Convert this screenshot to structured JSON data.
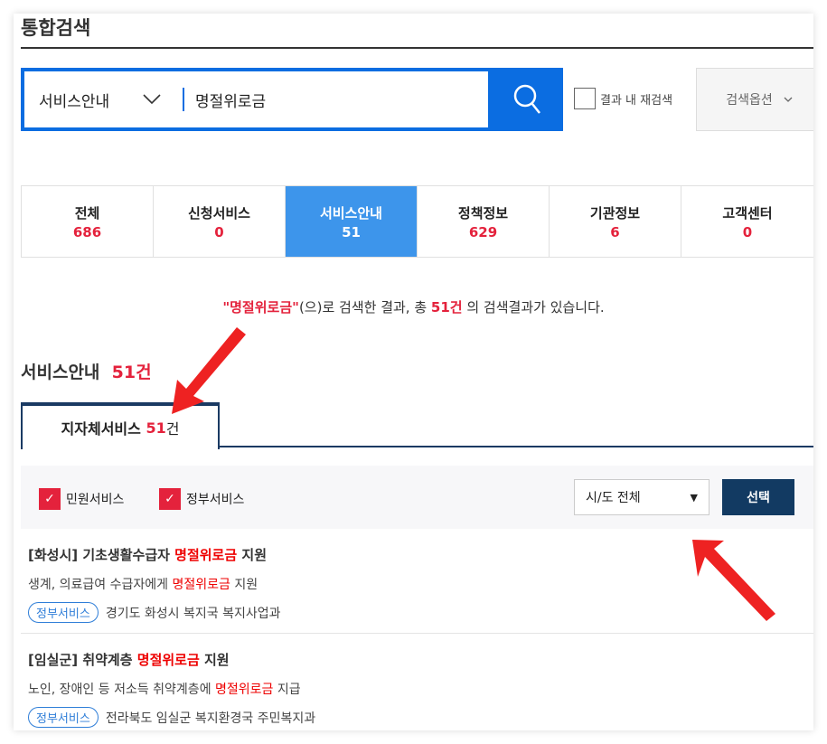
{
  "header": {
    "title": "통합검색"
  },
  "search": {
    "category": "서비스안내",
    "query": "명절위로금",
    "research_label": "결과 내 재검색",
    "options_label": "검색옵션",
    "icon": "search-icon"
  },
  "tabs": [
    {
      "label": "전체",
      "count": "686"
    },
    {
      "label": "신청서비스",
      "count": "0"
    },
    {
      "label": "서비스안내",
      "count": "51",
      "active": true
    },
    {
      "label": "정책정보",
      "count": "629"
    },
    {
      "label": "기관정보",
      "count": "6"
    },
    {
      "label": "고객센터",
      "count": "0"
    }
  ],
  "summary": {
    "q1": "\"명절위로금\"",
    "t1": "(으)로 검색한 결과, 총 ",
    "count": "51건",
    "t2": " 의 검색결과가 있습니다."
  },
  "section": {
    "title": "서비스안내",
    "count": "51건"
  },
  "subtab": {
    "label": "지자체서비스",
    "count": "51",
    "unit": "건"
  },
  "filter": {
    "checks": [
      {
        "label": "민원서비스",
        "checked": true
      },
      {
        "label": "정부서비스",
        "checked": true
      }
    ],
    "select": "시/도 전체",
    "button": "선택"
  },
  "results": [
    {
      "title_pre": "[화성시] 기초생활수급자 ",
      "title_hl": "명절위로금",
      "title_post": " 지원",
      "desc_pre": "생계, 의료급여 수급자에게 ",
      "desc_hl": "명절위로금",
      "desc_post": " 지원",
      "badge": "정부서비스",
      "org": "경기도 화성시 복지국 복지사업과"
    },
    {
      "title_pre": "[임실군] 취약계층 ",
      "title_hl": "명절위로금",
      "title_post": " 지원",
      "desc_pre": "노인, 장애인 등 저소득 취약계층에 ",
      "desc_hl": "명절위로금",
      "desc_post": " 지급",
      "badge": "정부서비스",
      "org": "전라북도 임실군 복지환경국 주민복지과"
    }
  ],
  "colors": {
    "primary": "#0b6de1",
    "active_tab": "#3d95eb",
    "accent_red": "#e4223c",
    "navy": "#123a62",
    "annotation": "#ee2222"
  }
}
